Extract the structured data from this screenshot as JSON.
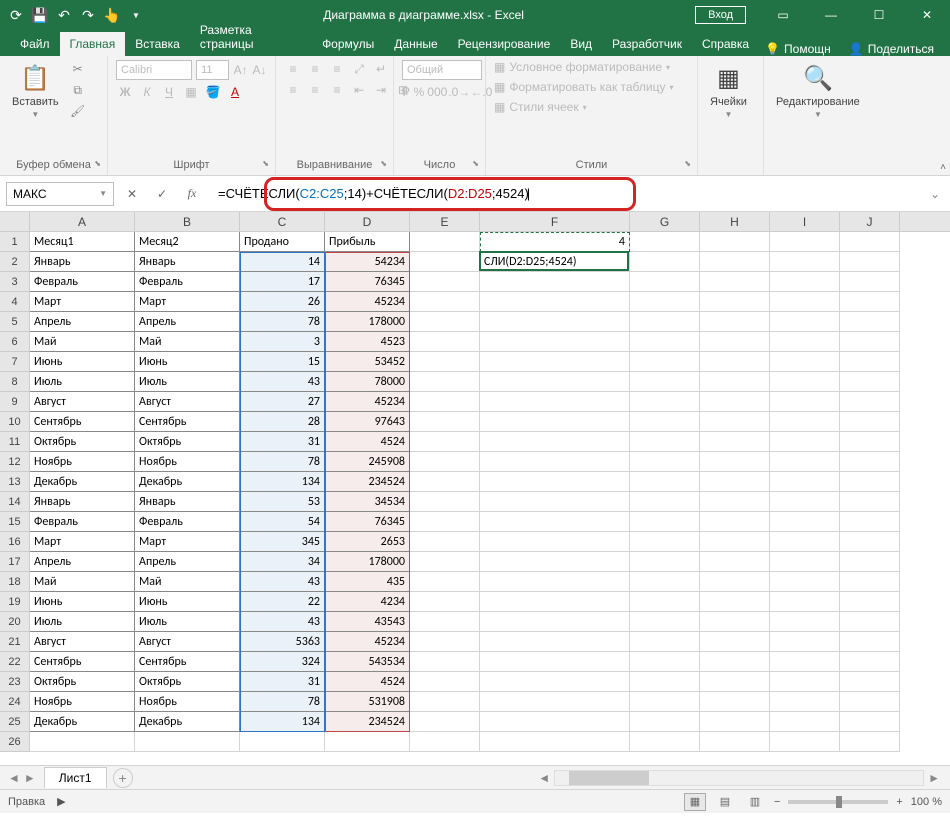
{
  "title": "Диаграмма в диаграмме.xlsx - Excel",
  "login_btn": "Вход",
  "tabs": [
    "Файл",
    "Главная",
    "Вставка",
    "Разметка страницы",
    "Формулы",
    "Данные",
    "Рецензирование",
    "Вид",
    "Разработчик",
    "Справка"
  ],
  "help_hint": "Помощн",
  "share": "Поделиться",
  "ribbon": {
    "clipboard": {
      "paste": "Вставить",
      "label": "Буфер обмена"
    },
    "font": {
      "name": "Calibri",
      "size": "11",
      "label": "Шрифт"
    },
    "alignment": {
      "label": "Выравнивание"
    },
    "number": {
      "format": "Общий",
      "label": "Число"
    },
    "styles": {
      "cond": "Условное форматирование",
      "table": "Форматировать как таблицу",
      "cell": "Стили ячеек",
      "label": "Стили"
    },
    "cells": {
      "label": "Ячейки"
    },
    "editing": {
      "label": "Редактирование"
    }
  },
  "name_box": "МАКС",
  "formula": {
    "prefix": "=СЧЁТЕСЛИ(",
    "range1": "C2:C25",
    "mid1": ";14)+СЧЁТЕСЛИ(",
    "range2": "D2:D25",
    "suffix": ";4524)"
  },
  "columns": [
    "A",
    "B",
    "C",
    "D",
    "E",
    "F",
    "G",
    "H",
    "I",
    "J"
  ],
  "headers": {
    "A": "Месяц1",
    "B": "Месяц2",
    "C": "Продано",
    "D": "Прибыль"
  },
  "f1_value": "4",
  "f2_display": "СЛИ(D2:D25;4524)",
  "rows": [
    {
      "a": "Январь",
      "b": "Январь",
      "c": 14,
      "d": 54234
    },
    {
      "a": "Февраль",
      "b": "Февраль",
      "c": 17,
      "d": 76345
    },
    {
      "a": "Март",
      "b": "Март",
      "c": 26,
      "d": 45234
    },
    {
      "a": "Апрель",
      "b": "Апрель",
      "c": 78,
      "d": 178000
    },
    {
      "a": "Май",
      "b": "Май",
      "c": 3,
      "d": 4523
    },
    {
      "a": "Июнь",
      "b": "Июнь",
      "c": 15,
      "d": 53452
    },
    {
      "a": "Июль",
      "b": "Июль",
      "c": 43,
      "d": 78000
    },
    {
      "a": "Август",
      "b": "Август",
      "c": 27,
      "d": 45234
    },
    {
      "a": "Сентябрь",
      "b": "Сентябрь",
      "c": 28,
      "d": 97643
    },
    {
      "a": "Октябрь",
      "b": "Октябрь",
      "c": 31,
      "d": 4524
    },
    {
      "a": "Ноябрь",
      "b": "Ноябрь",
      "c": 78,
      "d": 245908
    },
    {
      "a": "Декабрь",
      "b": "Декабрь",
      "c": 134,
      "d": 234524
    },
    {
      "a": "Январь",
      "b": "Январь",
      "c": 53,
      "d": 34534
    },
    {
      "a": "Февраль",
      "b": "Февраль",
      "c": 54,
      "d": 76345
    },
    {
      "a": "Март",
      "b": "Март",
      "c": 345,
      "d": 2653
    },
    {
      "a": "Апрель",
      "b": "Апрель",
      "c": 34,
      "d": 178000
    },
    {
      "a": "Май",
      "b": "Май",
      "c": 43,
      "d": 435
    },
    {
      "a": "Июнь",
      "b": "Июнь",
      "c": 22,
      "d": 4234
    },
    {
      "a": "Июль",
      "b": "Июль",
      "c": 43,
      "d": 43543
    },
    {
      "a": "Август",
      "b": "Август",
      "c": 5363,
      "d": 45234
    },
    {
      "a": "Сентябрь",
      "b": "Сентябрь",
      "c": 324,
      "d": 543534
    },
    {
      "a": "Октябрь",
      "b": "Октябрь",
      "c": 31,
      "d": 4524
    },
    {
      "a": "Ноябрь",
      "b": "Ноябрь",
      "c": 78,
      "d": 531908
    },
    {
      "a": "Декабрь",
      "b": "Декабрь",
      "c": 134,
      "d": 234524
    }
  ],
  "sheet_tab": "Лист1",
  "status": {
    "mode": "Правка",
    "zoom": "100 %"
  }
}
